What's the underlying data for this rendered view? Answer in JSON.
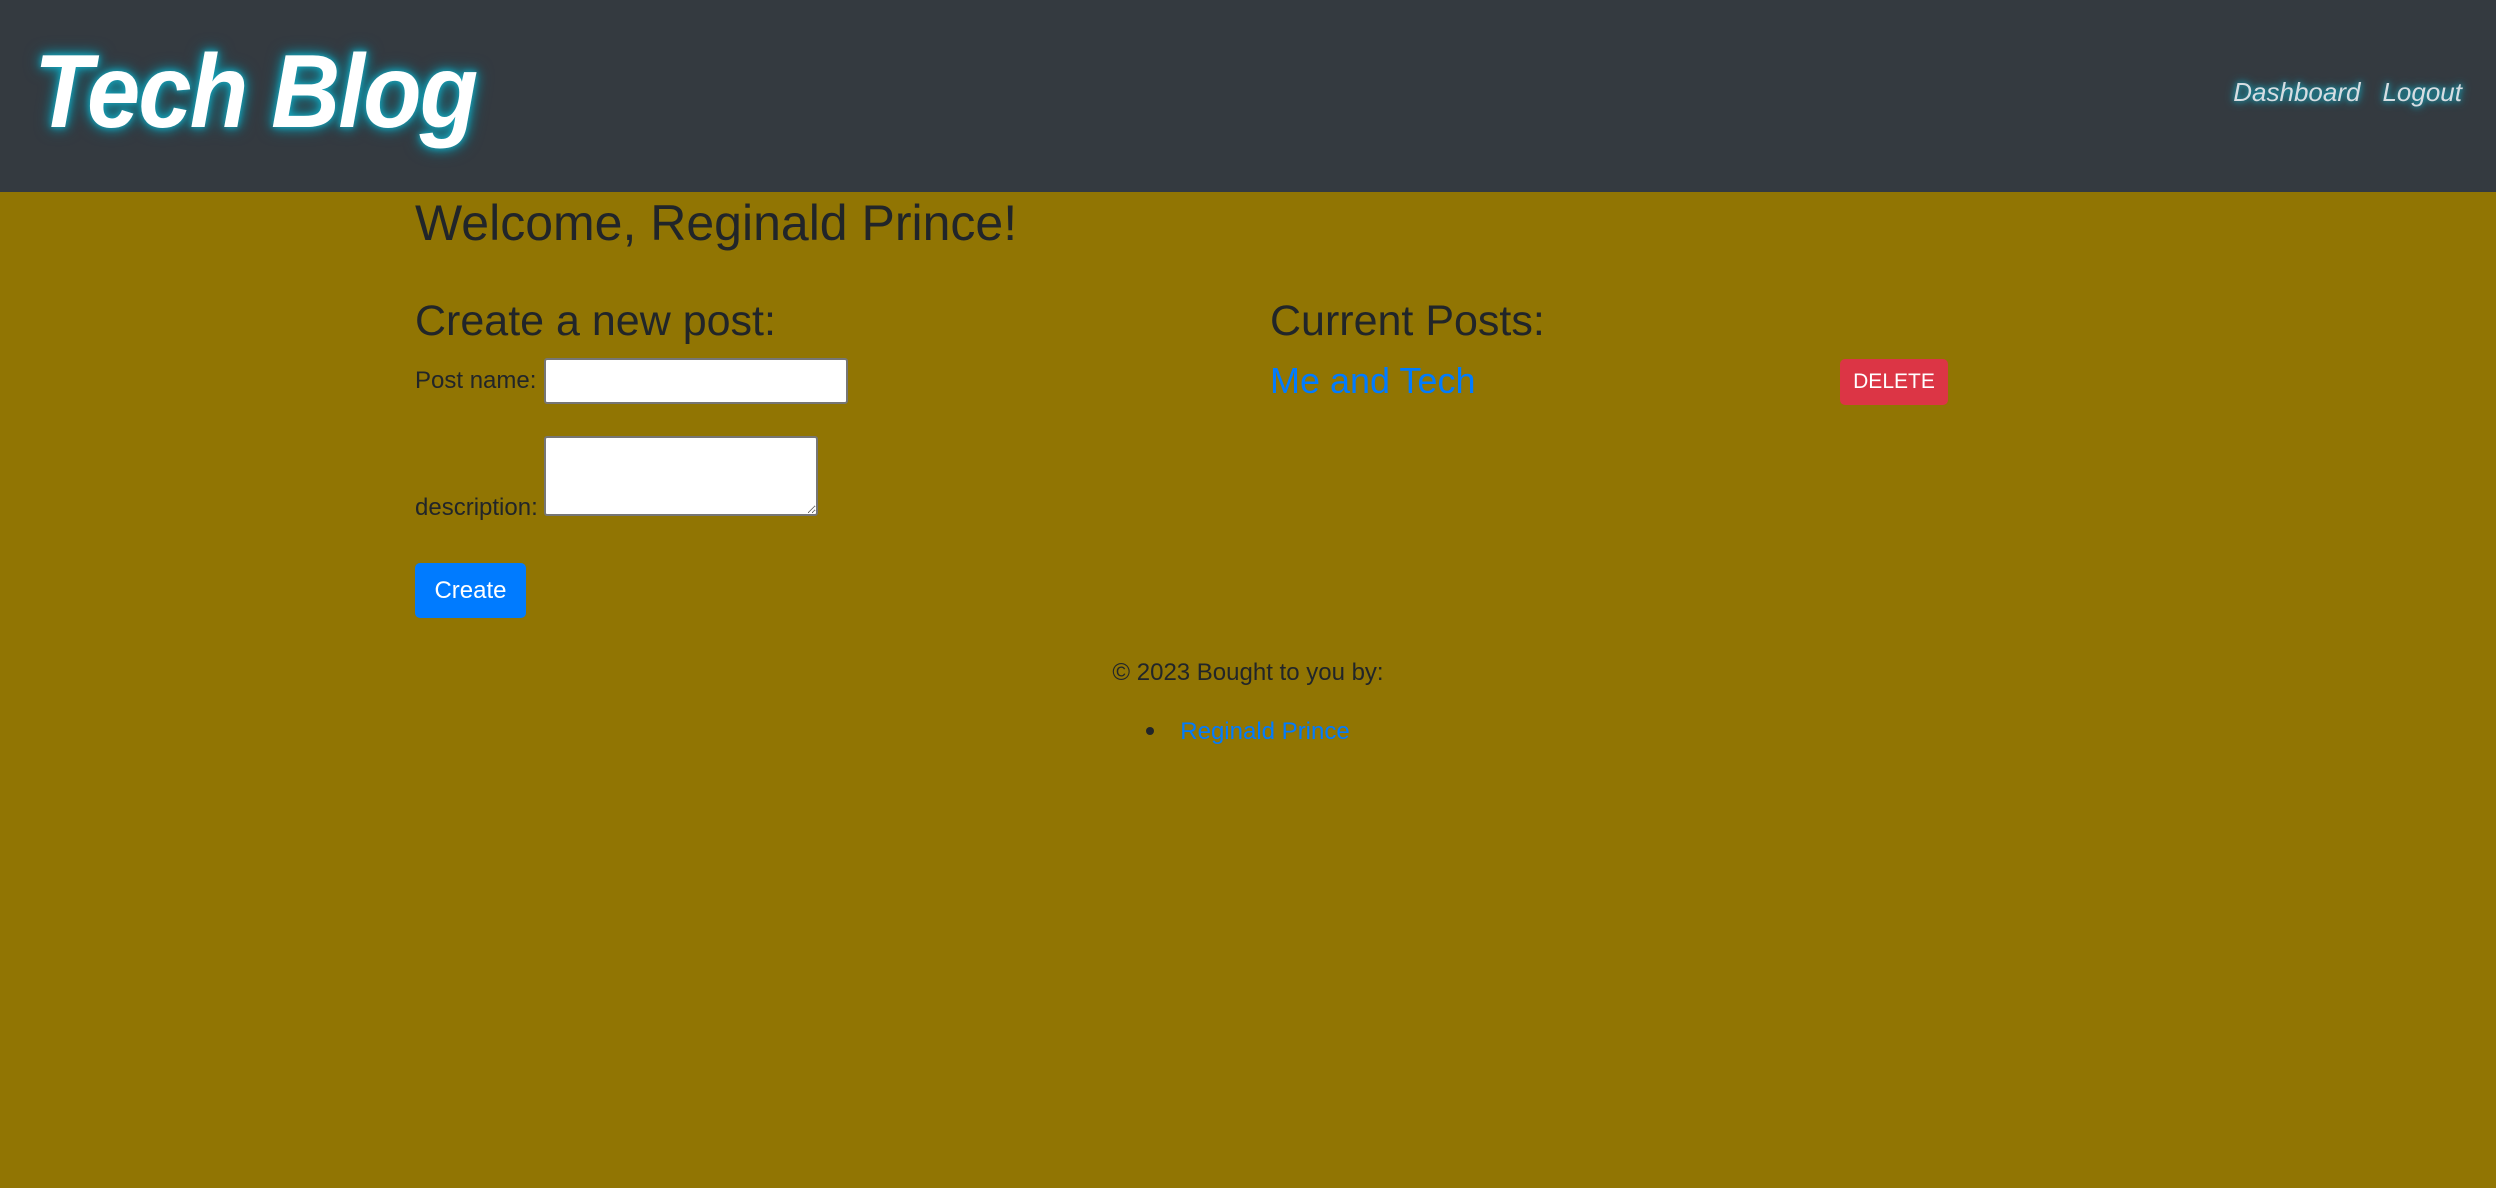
{
  "header": {
    "logo": "Tech Blog",
    "nav": {
      "dashboard": "Dashboard",
      "logout": "Logout"
    }
  },
  "main": {
    "welcome": "Welcome, Reginald Prince!",
    "create": {
      "title": "Create a new post:",
      "post_name_label": "Post name:",
      "post_name_value": "",
      "description_label": "description:",
      "description_value": "",
      "submit_label": "Create"
    },
    "posts": {
      "title": "Current Posts:",
      "items": [
        {
          "title": "Me and Tech",
          "delete_label": "DELETE"
        }
      ]
    }
  },
  "footer": {
    "text": "© 2023 Bought to you by:",
    "authors": [
      "Reginald Prince"
    ]
  },
  "colors": {
    "header_bg": "#343a40",
    "page_bg": "#917503",
    "primary": "#007bff",
    "danger": "#dc3545",
    "glow": "#17a2b8"
  }
}
